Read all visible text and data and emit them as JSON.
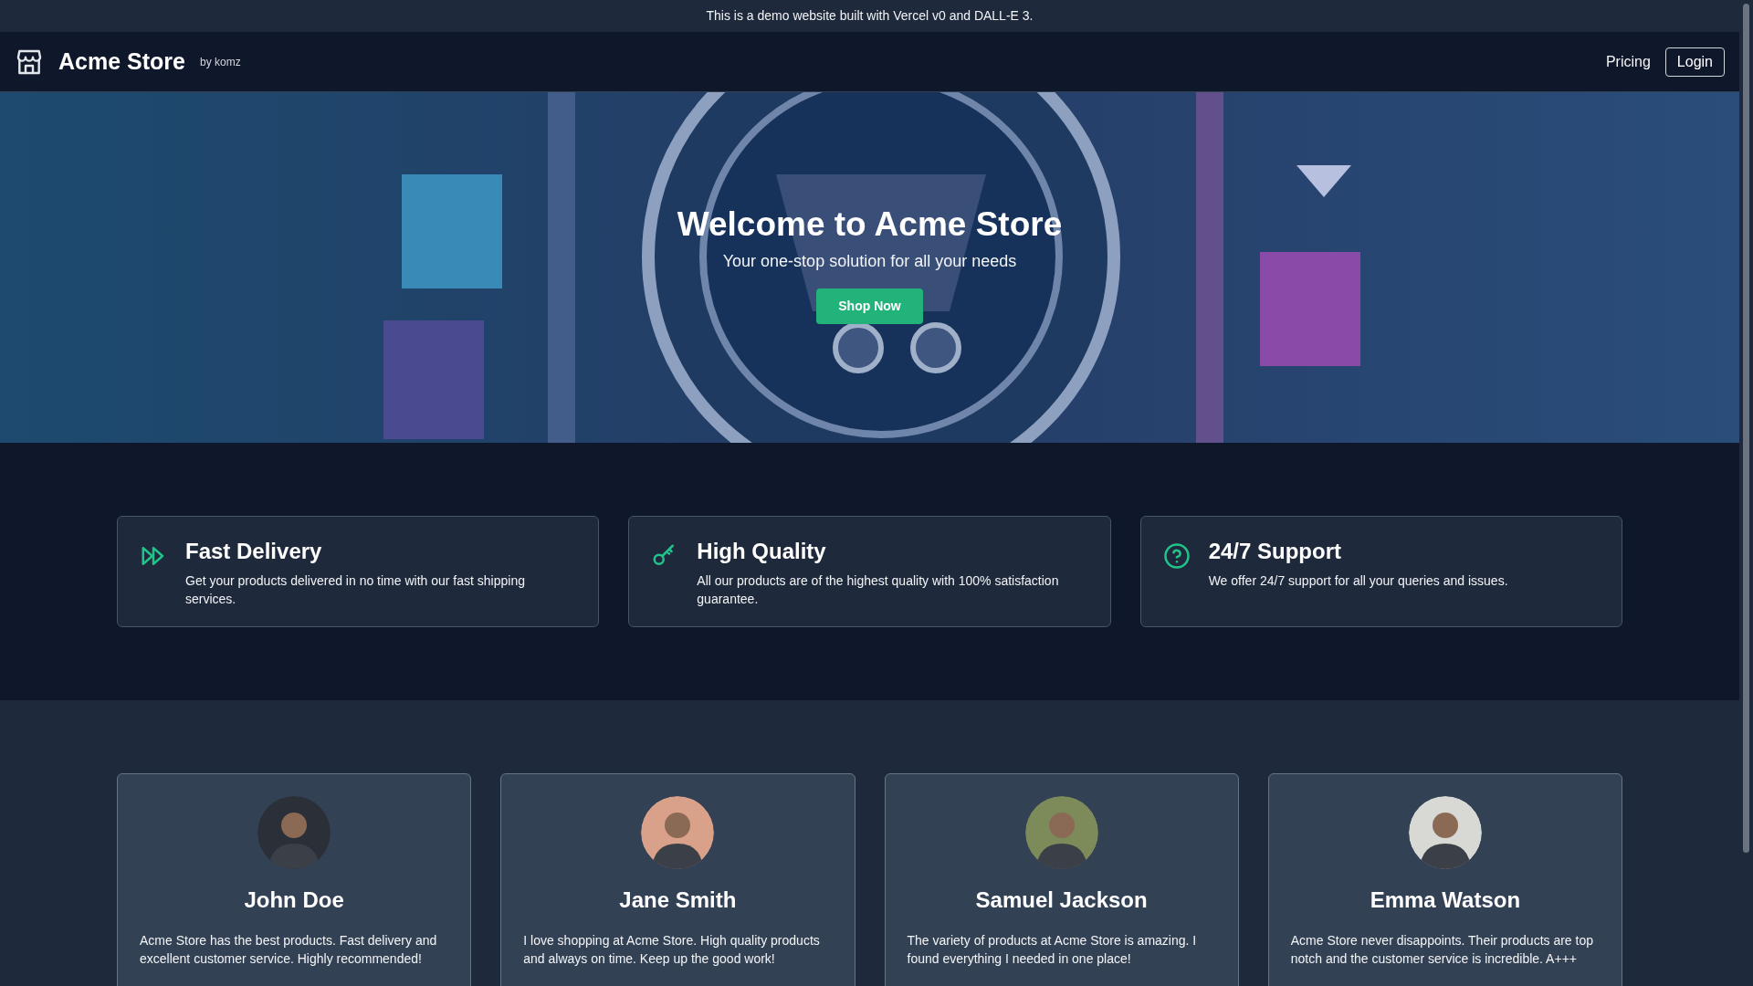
{
  "announcement": "This is a demo website built with Vercel v0 and DALL-E 3.",
  "header": {
    "brand": "Acme Store",
    "byline": "by komz",
    "nav": [
      {
        "label": "Pricing",
        "kind": "link"
      },
      {
        "label": "Login",
        "kind": "outlined"
      }
    ]
  },
  "hero": {
    "title": "Welcome to Acme Store",
    "subtitle": "Your one-stop solution for all your needs",
    "button": "Shop Now"
  },
  "features": [
    {
      "title": "Fast Delivery",
      "text": "Get your products delivered in no time with our fast shipping services."
    },
    {
      "title": "High Quality",
      "text": "All our products are of the highest quality with 100% satisfaction guarantee."
    },
    {
      "title": "24/7 Support",
      "text": "We offer 24/7 support for all your queries and issues."
    }
  ],
  "testimonials": [
    {
      "name": "John Doe",
      "text": "Acme Store has the best products. Fast delivery and excellent customer service. Highly recommended!",
      "color": "#2a2f38"
    },
    {
      "name": "Jane Smith",
      "text": "I love shopping at Acme Store. High quality products and always on time. Keep up the good work!",
      "color": "#d9a08a"
    },
    {
      "name": "Samuel Jackson",
      "text": "The variety of products at Acme Store is amazing. I found everything I needed in one place!",
      "color": "#7d8a5a"
    },
    {
      "name": "Emma Watson",
      "text": "Acme Store never disappoints. Their products are top notch and the customer service is incredible. A+++",
      "color": "#d8d8d4"
    }
  ]
}
